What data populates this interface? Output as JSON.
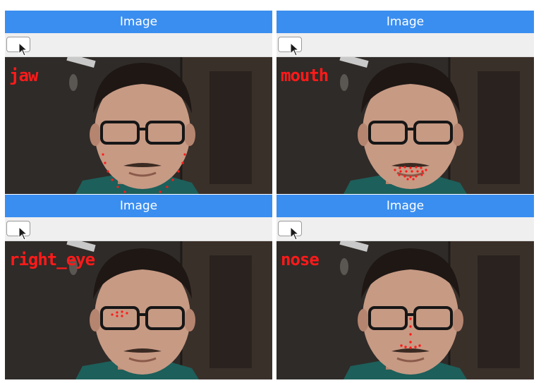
{
  "windows": [
    {
      "title": "Image",
      "overlay_label": "jaw"
    },
    {
      "title": "Image",
      "overlay_label": "mouth"
    },
    {
      "title": "Image",
      "overlay_label": "right_eye"
    },
    {
      "title": "Image",
      "overlay_label": "nose"
    }
  ],
  "colors": {
    "titlebar": "#3a8ef0",
    "landmark": "#ff1a1a",
    "toolbar": "#efefef"
  }
}
